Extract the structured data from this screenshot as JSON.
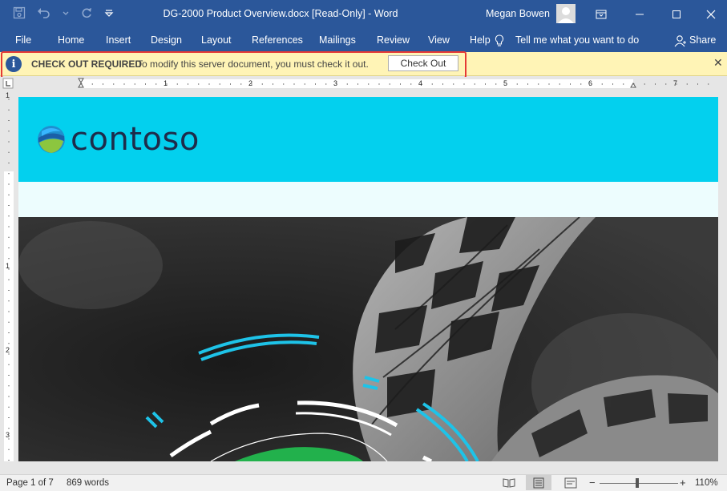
{
  "window": {
    "title": "DG-2000 Product Overview.docx [Read-Only]  -  Word",
    "user": "Megan Bowen"
  },
  "ribbon": {
    "tabs": [
      "File",
      "Home",
      "Insert",
      "Design",
      "Layout",
      "References",
      "Mailings",
      "Review",
      "View",
      "Help"
    ],
    "tell_me": "Tell me what you want to do",
    "share": "Share"
  },
  "message_bar": {
    "title": "CHECK OUT REQUIRED",
    "text": "To modify this server document, you must check it out.",
    "button": "Check Out"
  },
  "ruler": {
    "marks": [
      "1",
      "2",
      "3",
      "4",
      "5",
      "6",
      "7"
    ],
    "v_marks": [
      "1",
      "1",
      "2",
      "3"
    ]
  },
  "document": {
    "logo_text": "contoso"
  },
  "status": {
    "page": "Page 1 of 7",
    "words": "869 words",
    "zoom": "110%"
  },
  "colors": {
    "ribbon": "#2b579a",
    "header_band": "#03d0ee",
    "message_bar": "#fff4b6"
  }
}
